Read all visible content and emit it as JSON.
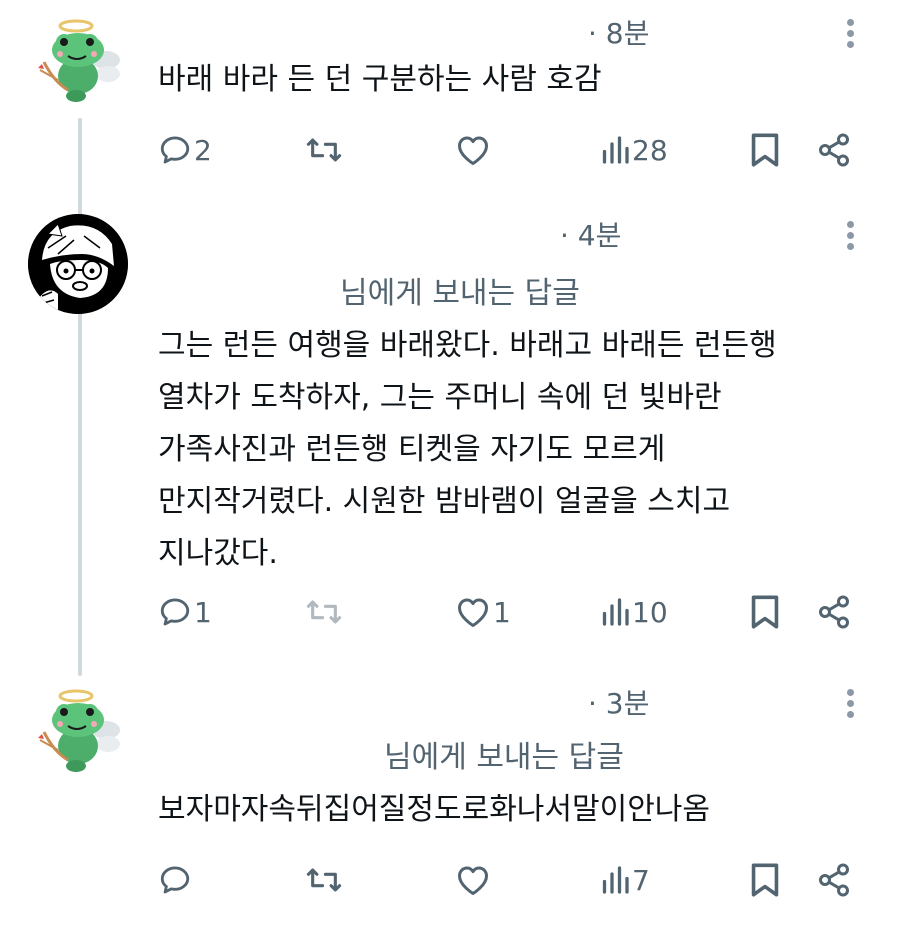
{
  "posts": [
    {
      "time": "· 8분",
      "reply_to": "",
      "text": "바래 바라 든 던 구분하는 사람 호감",
      "actions": {
        "replies": "2",
        "reposts": "",
        "likes": "",
        "views": "28"
      }
    },
    {
      "time": "· 4분",
      "reply_to": "님에게 보내는 답글",
      "text": "그는 런든 여행을 바래왔다. 바래고 바래든 런든행\n열차가 도착하자, 그는 주머니 속에 던 빛바란\n가족사진과 런든행 티켓을 자기도 모르게\n만지작거렸다. 시원한 밤바램이 얼굴을 스치고\n지나갔다.",
      "actions": {
        "replies": "1",
        "reposts": "",
        "likes": "1",
        "views": "10"
      }
    },
    {
      "time": "· 3분",
      "reply_to": "님에게 보내는 답글",
      "text": "보자마자속뒤집어질정도로화나서말이안나옴",
      "actions": {
        "replies": "",
        "reposts": "",
        "likes": "",
        "views": "7"
      }
    }
  ],
  "icons": {
    "reply": "speech-bubble-icon",
    "repost": "repost-arrows-icon",
    "like": "heart-icon",
    "views": "bar-chart-icon",
    "bookmark": "bookmark-icon",
    "share": "share-icon",
    "more": "vertical-dots-icon"
  },
  "colors": {
    "text": "#0f1419",
    "muted": "#536471",
    "thread_line": "#cfd9de",
    "frog_green": "#4cae6a"
  }
}
